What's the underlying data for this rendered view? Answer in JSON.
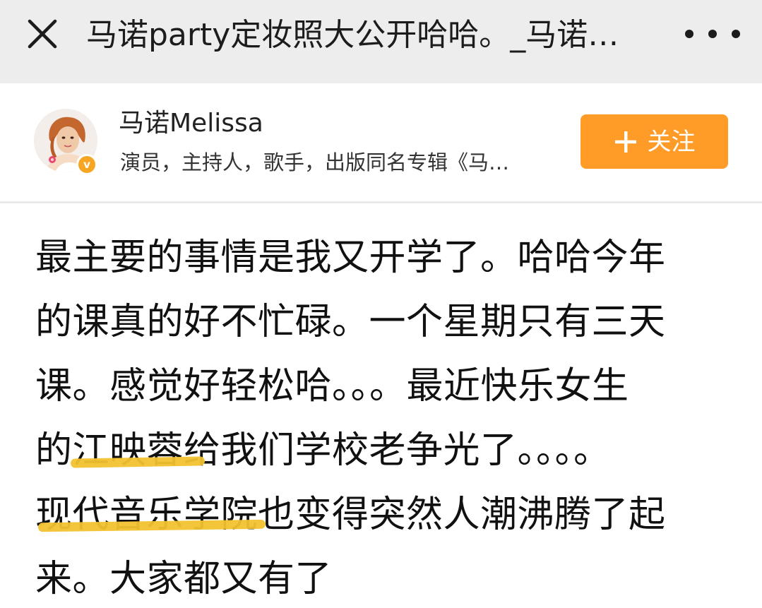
{
  "titlebar": {
    "title": "马诺party定妆照大公开哈哈。_马诺…",
    "close_icon": "close-icon",
    "more_icon": "more-dots-icon"
  },
  "profile": {
    "name": "马诺Melissa",
    "description": "演员，主持人，歌手，出版同名专辑《马…",
    "verified_badge": "v",
    "follow_label": "关注",
    "follow_color": "#ff9c27"
  },
  "post": {
    "lines": [
      "最主要的事情是我又开学了。哈哈今年",
      "的课真的好不忙碌。一个星期只有三天",
      "课。感觉好轻松哈。。。最近快乐女生",
      "的江映蓉给我们学校老争光了。。。。",
      "现代音乐学院也变得突然人潮沸腾了起",
      "来。大家都又有了"
    ],
    "highlight_color": "#f2c230"
  }
}
